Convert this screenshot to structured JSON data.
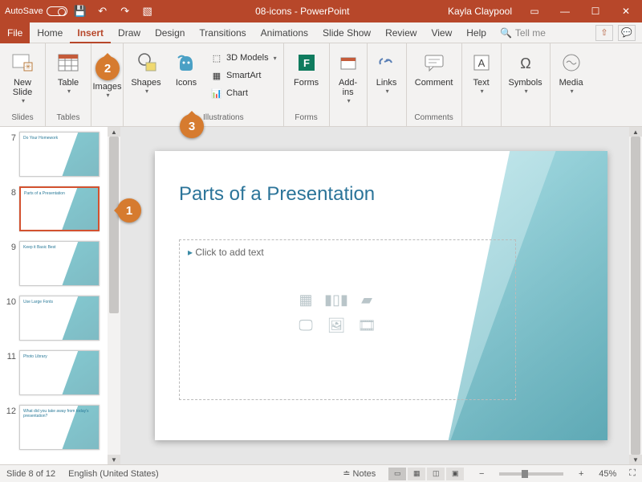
{
  "titlebar": {
    "autosave_label": "AutoSave",
    "doc_title": "08-icons - PowerPoint",
    "user_name": "Kayla Claypool"
  },
  "tabs": {
    "file": "File",
    "items": [
      "Home",
      "Insert",
      "Draw",
      "Design",
      "Transitions",
      "Animations",
      "Slide Show",
      "Review",
      "View",
      "Help"
    ],
    "active_index": 1,
    "tellme": "Tell me"
  },
  "ribbon": {
    "groups": {
      "slides": {
        "label": "Slides",
        "new_slide": "New\nSlide"
      },
      "tables": {
        "label": "Tables",
        "table": "Table"
      },
      "images": {
        "label": "",
        "images": "Images"
      },
      "illustrations": {
        "label": "Illustrations",
        "shapes": "Shapes",
        "icons": "Icons",
        "threed": "3D Models",
        "smartart": "SmartArt",
        "chart": "Chart"
      },
      "forms": {
        "label": "Forms",
        "forms": "Forms"
      },
      "addins": {
        "label": "",
        "addins": "Add-\nins"
      },
      "links": {
        "label": "",
        "links": "Links"
      },
      "comments": {
        "label": "Comments",
        "comment": "Comment"
      },
      "text": {
        "label": "",
        "text": "Text"
      },
      "symbols": {
        "label": "",
        "symbols": "Symbols"
      },
      "media": {
        "label": "",
        "media": "Media"
      }
    }
  },
  "thumbnails": [
    {
      "num": "7",
      "title": "Do Your Homework"
    },
    {
      "num": "8",
      "title": "Parts of a Presentation",
      "selected": true
    },
    {
      "num": "9",
      "title": "Keep it Basic Best"
    },
    {
      "num": "10",
      "title": "Use Large Fonts"
    },
    {
      "num": "11",
      "title": "Photo Library"
    },
    {
      "num": "12",
      "title": "What did you take away from today's presentation?"
    }
  ],
  "slide": {
    "title": "Parts of a Presentation",
    "placeholder": "Click to add text"
  },
  "status": {
    "slide_pos": "Slide 8 of 12",
    "language": "English (United States)",
    "notes": "Notes",
    "zoom": "45%"
  },
  "callouts": {
    "c1": "1",
    "c2": "2",
    "c3": "3"
  }
}
